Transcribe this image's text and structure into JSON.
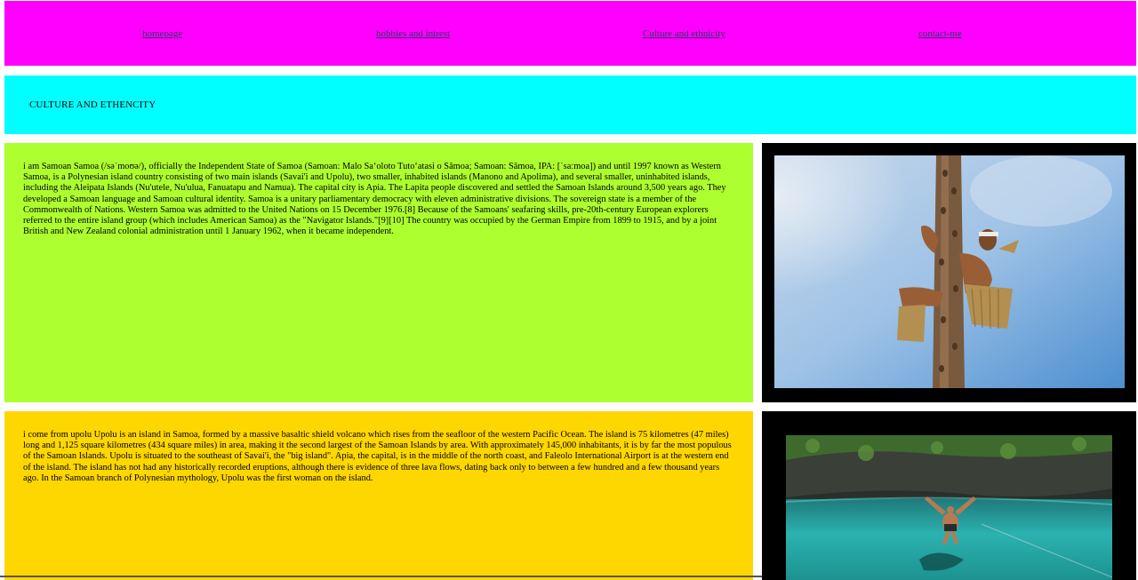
{
  "nav": {
    "links": [
      {
        "label": "homepage"
      },
      {
        "label": "hobbies and intrest"
      },
      {
        "label": "Culture and ethnicity"
      },
      {
        "label": "contact-me"
      }
    ]
  },
  "banner": {
    "title": "CULTURE AND ETHENCITY"
  },
  "sections": [
    {
      "text": "i am Samoan Samoa (/səˈmoʊə/), officially the Independent State of Samoa (Samoan: Malo Saʻoloto Tutoʻatasi o Sāmoa; Samoan: Sāmoa, IPA: [ˈsaːmoa]) and until 1997 known as Western Samoa, is a Polynesian island country consisting of two main islands (Savai'i and Upolu), two smaller, inhabited islands (Manono and Apolima), and several smaller, uninhabited islands, including the Aleipata Islands (Nu'utele, Nu'ulua, Fanuatapu and Namua). The capital city is Apia. The Lapita people discovered and settled the Samoan Islands around 3,500 years ago. They developed a Samoan language and Samoan cultural identity. Samoa is a unitary parliamentary democracy with eleven administrative divisions. The sovereign state is a member of the Commonwealth of Nations. Western Samoa was admitted to the United Nations on 15 December 1976.[8] Because of the Samoans' seafaring skills, pre-20th-century European explorers referred to the entire island group (which includes American Samoa) as the \"Navigator Islands.\"[9][10] The country was occupied by the German Empire from 1899 to 1915, and by a joint British and New Zealand colonial administration until 1 January 1962, when it became independent.",
      "background": "#adff2f"
    },
    {
      "text": "i come from upolu Upolu is an island in Samoa, formed by a massive basaltic shield volcano which rises from the seafloor of the western Pacific Ocean. The island is 75 kilometres (47 miles) long and 1,125 square kilometres (434 square miles) in area, making it the second largest of the Samoan Islands by area. With approximately 145,000 inhabitants, it is by far the most populous of the Samoan Islands. Upolu is situated to the southeast of Savai'i, the \"big island\". Apia, the capital, is in the middle of the north coast, and Faleolo International Airport is at the western end of the island. The island has not had any historically recorded eruptions, although there is evidence of three lava flows, dating back only to between a few hundred and a few thousand years ago. In the Samoan branch of Polynesian mythology, Upolu was the first woman on the island.",
      "background": "#ffd700"
    }
  ],
  "colors": {
    "nav": "#ff00ff",
    "banner": "#00ffff",
    "image_frame": "#000000"
  }
}
